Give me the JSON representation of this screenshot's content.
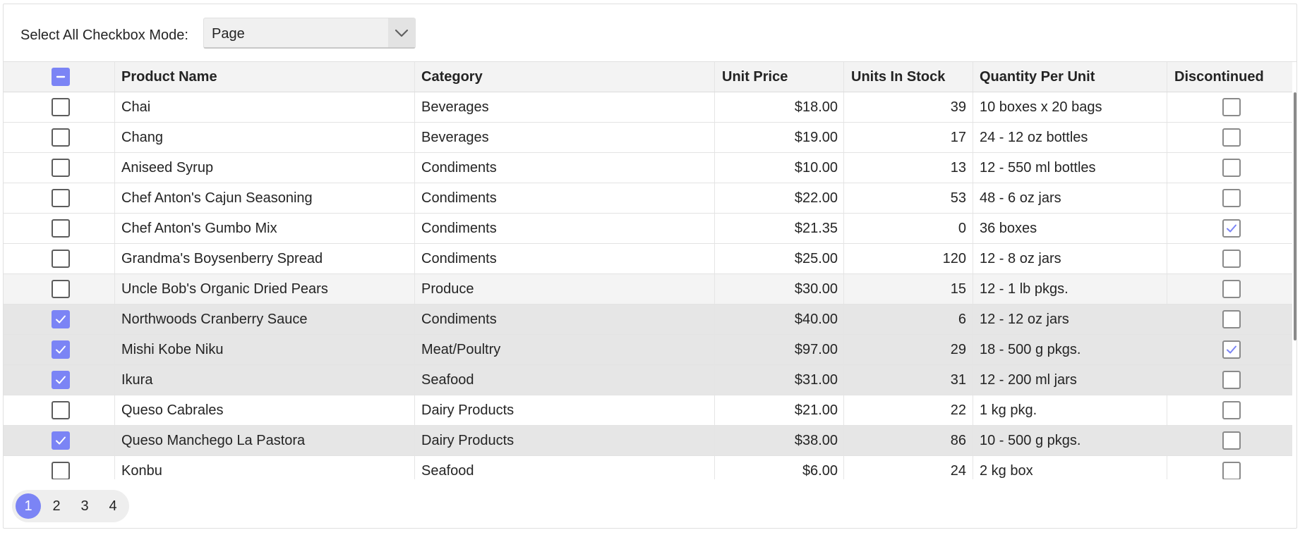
{
  "toolbar": {
    "label": "Select All Checkbox Mode:",
    "combo_value": "Page",
    "combo_icon": "chevron-down-icon"
  },
  "columns": {
    "select_all_state": "indeterminate",
    "product_name": "Product Name",
    "category": "Category",
    "unit_price": "Unit Price",
    "units_in_stock": "Units In Stock",
    "quantity_per_unit": "Quantity Per Unit",
    "discontinued": "Discontinued"
  },
  "rows": [
    {
      "selected": false,
      "state": "normal",
      "name": "Chai",
      "category": "Beverages",
      "price": "$18.00",
      "stock": "39",
      "qty": "10 boxes x 20 bags",
      "discontinued": false
    },
    {
      "selected": false,
      "state": "normal",
      "name": "Chang",
      "category": "Beverages",
      "price": "$19.00",
      "stock": "17",
      "qty": "24 - 12 oz bottles",
      "discontinued": false
    },
    {
      "selected": false,
      "state": "normal",
      "name": "Aniseed Syrup",
      "category": "Condiments",
      "price": "$10.00",
      "stock": "13",
      "qty": "12 - 550 ml bottles",
      "discontinued": false
    },
    {
      "selected": false,
      "state": "normal",
      "name": "Chef Anton's Cajun Seasoning",
      "category": "Condiments",
      "price": "$22.00",
      "stock": "53",
      "qty": "48 - 6 oz jars",
      "discontinued": false
    },
    {
      "selected": false,
      "state": "normal",
      "name": "Chef Anton's Gumbo Mix",
      "category": "Condiments",
      "price": "$21.35",
      "stock": "0",
      "qty": "36 boxes",
      "discontinued": true
    },
    {
      "selected": false,
      "state": "normal",
      "name": "Grandma's Boysenberry Spread",
      "category": "Condiments",
      "price": "$25.00",
      "stock": "120",
      "qty": "12 - 8 oz jars",
      "discontinued": false
    },
    {
      "selected": false,
      "state": "hover",
      "name": "Uncle Bob's Organic Dried Pears",
      "category": "Produce",
      "price": "$30.00",
      "stock": "15",
      "qty": "12 - 1 lb pkgs.",
      "discontinued": false
    },
    {
      "selected": true,
      "state": "selected",
      "name": "Northwoods Cranberry Sauce",
      "category": "Condiments",
      "price": "$40.00",
      "stock": "6",
      "qty": "12 - 12 oz jars",
      "discontinued": false
    },
    {
      "selected": true,
      "state": "selected",
      "name": "Mishi Kobe Niku",
      "category": "Meat/Poultry",
      "price": "$97.00",
      "stock": "29",
      "qty": "18 - 500 g pkgs.",
      "discontinued": true
    },
    {
      "selected": true,
      "state": "selected",
      "name": "Ikura",
      "category": "Seafood",
      "price": "$31.00",
      "stock": "31",
      "qty": "12 - 200 ml jars",
      "discontinued": false
    },
    {
      "selected": false,
      "state": "normal",
      "name": "Queso Cabrales",
      "category": "Dairy Products",
      "price": "$21.00",
      "stock": "22",
      "qty": "1 kg pkg.",
      "discontinued": false
    },
    {
      "selected": true,
      "state": "selected",
      "name": "Queso Manchego La Pastora",
      "category": "Dairy Products",
      "price": "$38.00",
      "stock": "86",
      "qty": "10 - 500 g pkgs.",
      "discontinued": false
    },
    {
      "selected": false,
      "state": "normal",
      "name": "Konbu",
      "category": "Seafood",
      "price": "$6.00",
      "stock": "24",
      "qty": "2 kg box",
      "discontinued": false
    }
  ],
  "pager": {
    "pages": [
      "1",
      "2",
      "3",
      "4"
    ],
    "active_page": "1"
  },
  "colors": {
    "accent": "#7b84f5",
    "selected_row": "#e6e6e6",
    "hover_row": "#f4f4f4",
    "header_bg": "#f3f3f3"
  }
}
